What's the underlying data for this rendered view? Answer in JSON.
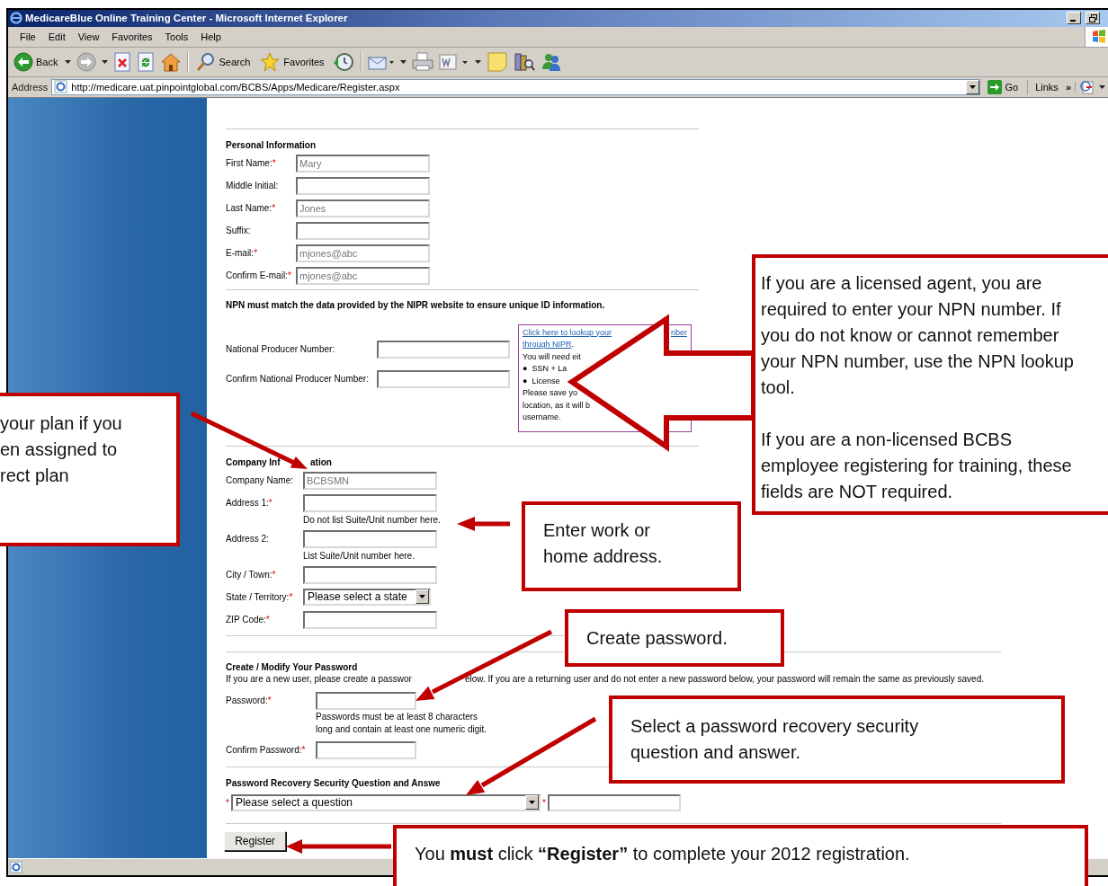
{
  "window": {
    "title": "MedicareBlue Online Training Center - Microsoft Internet Explorer"
  },
  "menu": [
    "File",
    "Edit",
    "View",
    "Favorites",
    "Tools",
    "Help"
  ],
  "toolbar": [
    {
      "kind": "back",
      "label": "Back"
    },
    {
      "kind": "forward"
    },
    {
      "kind": "stop"
    },
    {
      "kind": "refresh"
    },
    {
      "kind": "home"
    },
    {
      "kind": "search",
      "label": "Search"
    },
    {
      "kind": "favorites",
      "label": "Favorites"
    },
    {
      "kind": "history"
    },
    {
      "kind": "mail"
    },
    {
      "kind": "print"
    },
    {
      "kind": "edit"
    },
    {
      "kind": "notes"
    },
    {
      "kind": "research"
    },
    {
      "kind": "messenger"
    }
  ],
  "address_bar": {
    "label": "Address",
    "url": "http://medicare.uat.pinpointglobal.com/BCBS/Apps/Medicare/Register.aspx",
    "go": "Go",
    "links": "Links",
    "more": "»"
  },
  "personal": {
    "heading": "Personal Information",
    "fields": [
      {
        "label": "First Name:",
        "mark": "*",
        "value": "Mary"
      },
      {
        "label": "Middle Initial:"
      },
      {
        "label": "Last Name:",
        "mark": "*",
        "value": "Jones"
      },
      {
        "label": "Suffix:"
      },
      {
        "label": "E-mail:",
        "mark": "*",
        "value": "mjones@abc"
      },
      {
        "label": "Confirm E-mail:",
        "mark": "*",
        "value": "mjones@abc"
      }
    ]
  },
  "npn": {
    "note": "NPN must match the data provided by the NIPR website to ensure unique ID information.",
    "fields": [
      {
        "label": "National Producer Number:"
      },
      {
        "label": "Confirm National Producer Number:"
      }
    ],
    "help": {
      "link": "Click here to lookup your",
      "link_tail": "nber",
      "link_2": "through NIPR",
      "link_end": ".",
      "intro": "You will need eit",
      "bullets": [
        {
          "mark": "●",
          "text": "SSN + La"
        },
        {
          "mark": "●",
          "text": "License"
        }
      ],
      "after": [
        "Please save yo",
        "location, as it will b",
        "username."
      ]
    }
  },
  "company": {
    "heading": "Company Inf",
    "heading_tail": "ation",
    "fields": [
      {
        "kind": "text",
        "label": "Company Name:",
        "value": "BCBSMN"
      },
      {
        "kind": "text",
        "label": "Address 1:",
        "mark": "*",
        "hint": "Do not list Suite/Unit number here."
      },
      {
        "kind": "text",
        "label": "Address 2:",
        "hint": "List Suite/Unit number here."
      },
      {
        "kind": "text",
        "label": "City / Town:",
        "mark": "*"
      },
      {
        "kind": "select",
        "label": "State / Territory:",
        "mark": "*",
        "value": "Please select a state"
      },
      {
        "kind": "text",
        "label": "ZIP Code:",
        "mark": "*"
      }
    ]
  },
  "password": {
    "heading": "Create / Modify Your Password",
    "description": "If you are a new user, please create a passwor",
    "description_tail": "elow. If you are a returning user and do not enter a new password below, your password will remain the same as previously saved.",
    "fields": [
      {
        "label": "Password:",
        "mark": "*",
        "hint": "Passwords must be at least 8 characters long and contain at least one numeric digit."
      },
      {
        "label": "Confirm Password:",
        "mark": "*"
      }
    ]
  },
  "recovery": {
    "heading": "Password Recovery Security Question and Answe",
    "mark": "*",
    "question": "Please select a question",
    "answer_mark": "*"
  },
  "register_button": "Register",
  "callouts": [
    {
      "kind": "left",
      "paragraphs": [
        "your plan if you\nen assigned to\nrect plan"
      ]
    },
    {
      "kind": "npn",
      "paragraphs": [
        "If you are a licensed agent, you are required to enter your NPN number. If you do not know or cannot remember your NPN number, use the NPN lookup tool.",
        "If you are a non-licensed BCBS employee registering for training, these fields are NOT required."
      ]
    },
    {
      "kind": "address",
      "paragraphs": [
        "Enter work or home address."
      ]
    },
    {
      "kind": "password",
      "paragraphs": [
        "Create password."
      ]
    },
    {
      "kind": "security",
      "paragraphs": [
        "Select a password recovery security question and answer."
      ]
    },
    {
      "kind": "register",
      "paragraphs": [
        "You **must** click **“Register”** to complete your 2012 registration."
      ]
    }
  ]
}
